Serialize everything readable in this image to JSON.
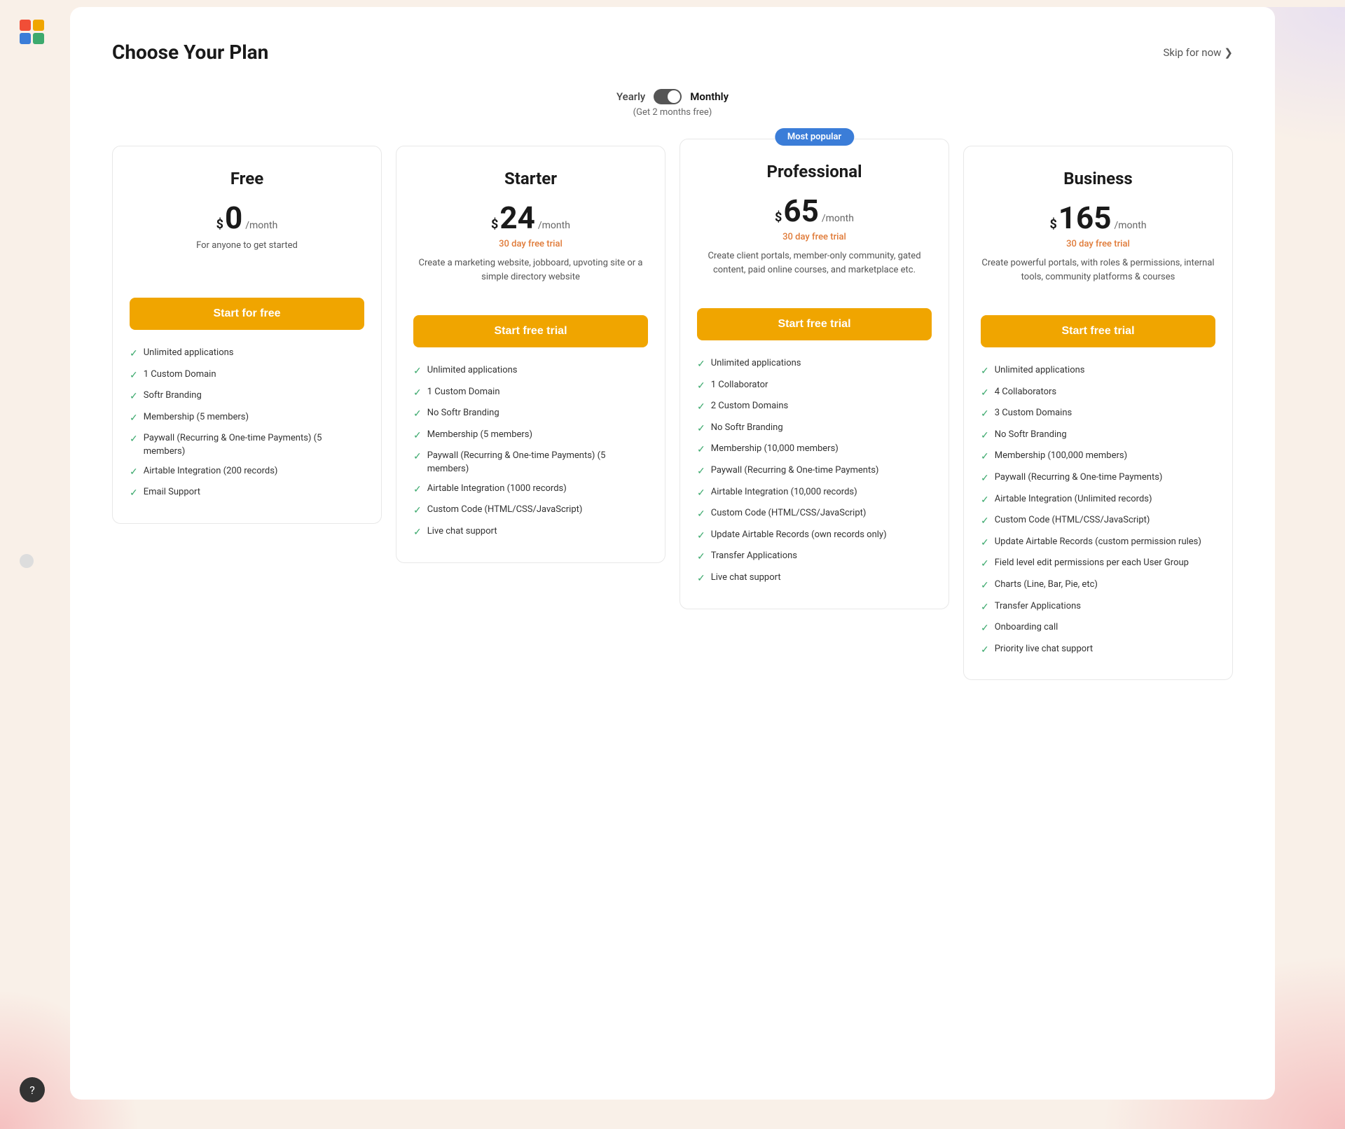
{
  "app": {
    "logo_colors": [
      "#f04e37",
      "#f0a500",
      "#3b7dd8",
      "#3daa6e"
    ]
  },
  "header": {
    "title": "Choose Your Plan",
    "skip_label": "Skip for now",
    "skip_icon": "❯"
  },
  "billing_toggle": {
    "yearly_label": "Yearly",
    "monthly_label": "Monthly",
    "sub_text": "(Get 2 months free)"
  },
  "plans": [
    {
      "id": "free",
      "name": "Free",
      "price_symbol": "$",
      "price": "0",
      "period": "/month",
      "trial_text": "",
      "description": "For anyone to get started",
      "cta_label": "Start for free",
      "popular": false,
      "features": [
        "Unlimited applications",
        "1 Custom Domain",
        "Softr Branding",
        "Membership (5 members)",
        "Paywall (Recurring & One-time Payments) (5 members)",
        "Airtable Integration (200 records)",
        "Email Support"
      ]
    },
    {
      "id": "starter",
      "name": "Starter",
      "price_symbol": "$",
      "price": "24",
      "period": "/month",
      "trial_text": "30 day free trial",
      "description": "Create a marketing website, jobboard, upvoting site or a simple directory website",
      "cta_label": "Start free trial",
      "popular": false,
      "features": [
        "Unlimited applications",
        "1 Custom Domain",
        "No Softr Branding",
        "Membership (5 members)",
        "Paywall (Recurring & One-time Payments) (5 members)",
        "Airtable Integration (1000 records)",
        "Custom Code (HTML/CSS/JavaScript)",
        "Live chat support"
      ]
    },
    {
      "id": "professional",
      "name": "Professional",
      "price_symbol": "$",
      "price": "65",
      "period": "/month",
      "trial_text": "30 day free trial",
      "description": "Create client portals, member-only community, gated content, paid online courses, and marketplace etc.",
      "cta_label": "Start free trial",
      "popular": true,
      "popular_badge": "Most popular",
      "features": [
        "Unlimited applications",
        "1 Collaborator",
        "2 Custom Domains",
        "No Softr Branding",
        "Membership (10,000 members)",
        "Paywall (Recurring & One-time Payments)",
        "Airtable Integration (10,000 records)",
        "Custom Code (HTML/CSS/JavaScript)",
        "Update Airtable Records (own records only)",
        "Transfer Applications",
        "Live chat support"
      ]
    },
    {
      "id": "business",
      "name": "Business",
      "price_symbol": "$",
      "price": "165",
      "period": "/month",
      "trial_text": "30 day free trial",
      "description": "Create powerful portals, with roles & permissions, internal tools, community platforms & courses",
      "cta_label": "Start free trial",
      "popular": false,
      "features": [
        "Unlimited applications",
        "4 Collaborators",
        "3 Custom Domains",
        "No Softr Branding",
        "Membership (100,000 members)",
        "Paywall (Recurring & One-time Payments)",
        "Airtable Integration (Unlimited records)",
        "Custom Code (HTML/CSS/JavaScript)",
        "Update Airtable Records (custom permission rules)",
        "Field level edit permissions per each User Group",
        "Charts (Line, Bar, Pie, etc)",
        "Transfer Applications",
        "Onboarding call",
        "Priority live chat support"
      ]
    }
  ],
  "help": {
    "icon": "?"
  }
}
